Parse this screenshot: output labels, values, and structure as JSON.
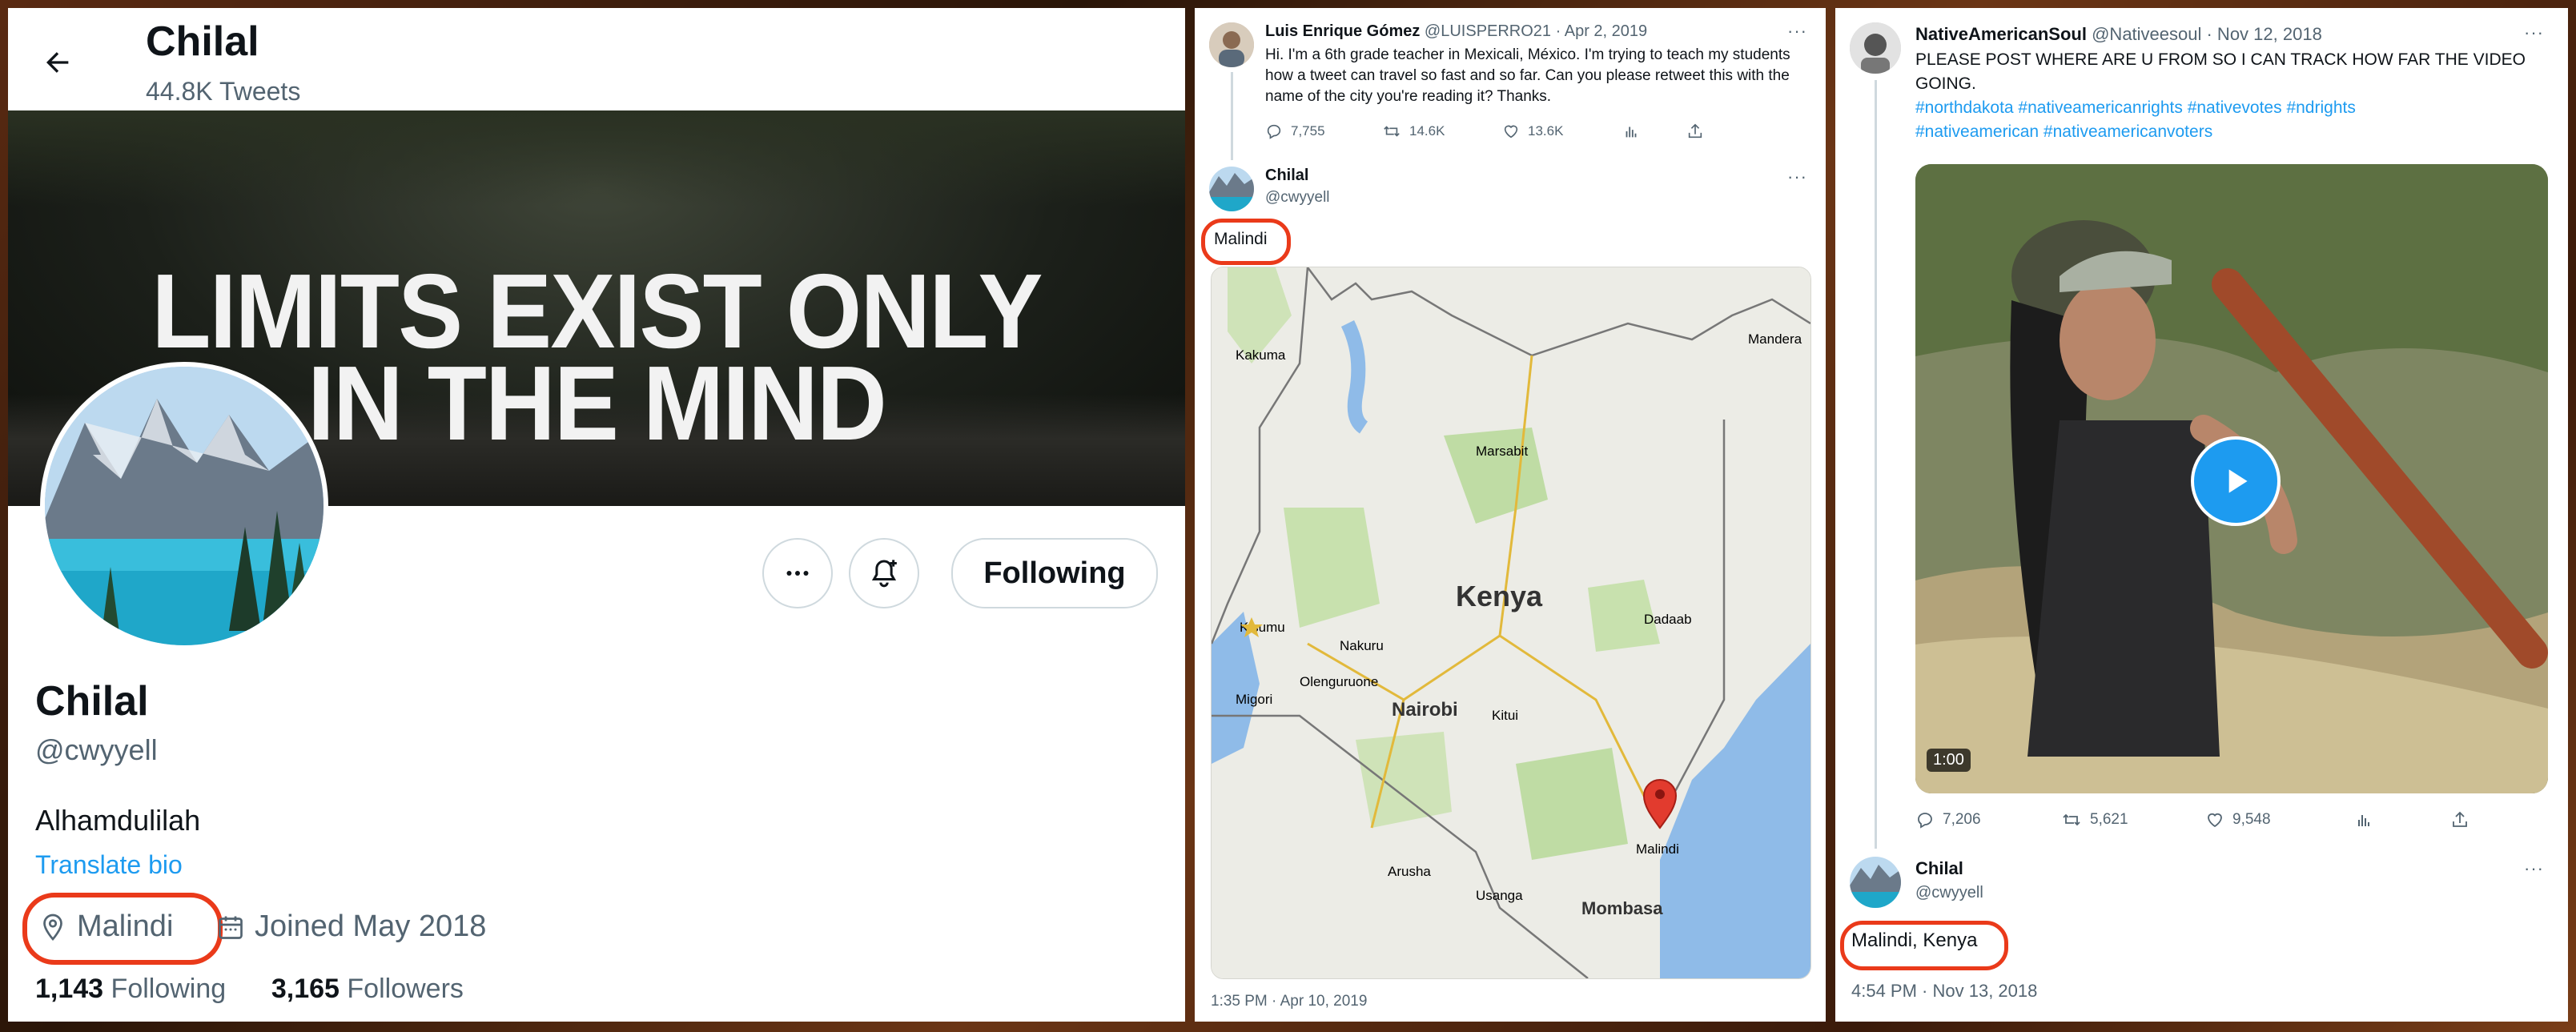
{
  "profile": {
    "header_name": "Chilal",
    "tweet_count": "44.8K Tweets",
    "banner_line1": "LIMITS EXIST ONLY",
    "banner_line2": "IN THE MIND",
    "follow_label": "Following",
    "name": "Chilal",
    "handle": "@cwyyell",
    "bio": "Alhamdulilah",
    "translate": "Translate bio",
    "location": "Malindi",
    "joined": "Joined May 2018",
    "following_count": "1,143",
    "following_label": "Following",
    "followers_count": "3,165",
    "followers_label": "Followers",
    "highlight_color": "#ea3a1a"
  },
  "tweet2": {
    "orig_name": "Luis Enrique Gómez",
    "orig_meta": "@LUISPERRO21 · Apr 2, 2019",
    "orig_text": "Hi. I'm a 6th grade teacher in Mexicali, México. I'm trying to teach my students how a tweet can travel so fast and so far. Can you please retweet this with the name of the city you're reading it? Thanks.",
    "replies": "7,755",
    "retweets": "14.6K",
    "likes": "13.6K",
    "reply_name": "Chilal",
    "reply_handle": "@cwyyell",
    "reply_text": "Malindi",
    "map_labels": {
      "kenya": "Kenya",
      "nairobi": "Nairobi",
      "mombasa": "Mombasa",
      "marsabit": "Marsabit",
      "kakuma": "Kakuma",
      "nakuru": "Nakuru",
      "dadaab": "Dadaab",
      "kisumu": "Kisumu",
      "kitui": "Kitui",
      "arusha": "Arusha",
      "malindi": "Malindi",
      "mandera": "Mandera",
      "migori": "Migori",
      "olenguruone": "Olenguruone",
      "usanga": "Usanga"
    },
    "timestamp": "1:35 PM · Apr 10, 2019"
  },
  "tweet3": {
    "orig_name": "NativeAmericanSoul",
    "orig_meta": "@Nativeesoul · Nov 12, 2018",
    "orig_text": "PLEASE POST WHERE ARE U FROM SO I CAN TRACK HOW FAR THE VIDEO GOING.",
    "hashtags1": "#northdakota #nativeamericanrights #nativevotes #ndrights",
    "hashtags2": "#nativeamerican #nativeamericanvoters",
    "duration": "1:00",
    "replies": "7,206",
    "retweets": "5,621",
    "likes": "9,548",
    "reply_name": "Chilal",
    "reply_handle": "@cwyyell",
    "reply_text": "Malindi, Kenya",
    "timestamp": "4:54 PM · Nov 13, 2018"
  },
  "icons": [
    "back-arrow-icon",
    "more-icon",
    "notification-bell-icon",
    "location-pin-icon",
    "calendar-icon",
    "reply-icon",
    "retweet-icon",
    "like-icon",
    "analytics-icon",
    "share-icon",
    "play-icon",
    "map-pin-icon"
  ]
}
